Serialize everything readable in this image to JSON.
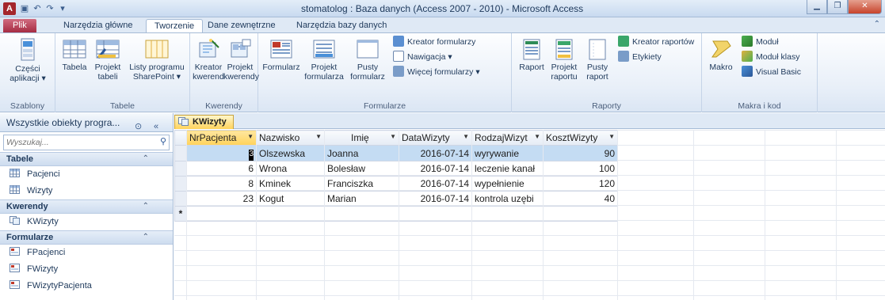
{
  "window": {
    "title": "stomatolog : Baza danych (Access 2007 - 2010)  -  Microsoft Access",
    "app_icon_letter": "A",
    "quick_access": [
      "save-icon",
      "undo-icon",
      "redo-icon",
      "customize-icon"
    ],
    "controls": [
      "minimize",
      "maximize",
      "close"
    ]
  },
  "tabs": [
    {
      "label": "Plik",
      "active": false
    },
    {
      "label": "Narzędzia główne",
      "active": false
    },
    {
      "label": "Tworzenie",
      "active": true
    },
    {
      "label": "Dane zewnętrzne",
      "active": false
    },
    {
      "label": "Narzędzia bazy danych",
      "active": false
    }
  ],
  "ribbon": {
    "groups": {
      "szablony": {
        "label": "Szablony",
        "buttons": [
          {
            "label": "Części\naplikacji ▾"
          }
        ]
      },
      "tabele": {
        "label": "Tabele",
        "buttons": [
          {
            "label": "Tabela"
          },
          {
            "label": "Projekt\ntabeli"
          },
          {
            "label": "Listy programu\nSharePoint ▾"
          }
        ]
      },
      "kwerendy": {
        "label": "Kwerendy",
        "buttons": [
          {
            "label": "Kreator\nkwerend"
          },
          {
            "label": "Projekt\nkwerendy"
          }
        ]
      },
      "formularze": {
        "label": "Formularze",
        "buttons": [
          {
            "label": "Formularz"
          },
          {
            "label": "Projekt\nformularza"
          },
          {
            "label": "Pusty\nformularz"
          }
        ],
        "small": [
          "Kreator formularzy",
          "Nawigacja ▾",
          "Więcej formularzy ▾"
        ]
      },
      "raporty": {
        "label": "Raporty",
        "buttons": [
          {
            "label": "Raport"
          },
          {
            "label": "Projekt\nraportu"
          },
          {
            "label": "Pusty\nraport"
          }
        ],
        "small": [
          "Kreator raportów",
          "Etykiety"
        ]
      },
      "makra": {
        "label": "Makra i kod",
        "buttons": [
          {
            "label": "Makro"
          }
        ],
        "small": [
          "Moduł",
          "Moduł klasy",
          "Visual Basic"
        ]
      }
    }
  },
  "nav": {
    "header": "Wszystkie obiekty progra...",
    "search_placeholder": "Wyszukaj...",
    "groups": [
      {
        "label": "Tabele",
        "items": [
          "Pacjenci",
          "Wizyty"
        ]
      },
      {
        "label": "Kwerendy",
        "items": [
          "KWizyty"
        ]
      },
      {
        "label": "Formularze",
        "items": [
          "FPacjenci",
          "FWizyty",
          "FWizytyPacjenta"
        ]
      }
    ]
  },
  "document": {
    "tab_label": "KWizyty",
    "columns": [
      "NrPacjenta",
      "Nazwisko",
      "Imię",
      "DataWizyty",
      "RodzajWizyt",
      "KosztWizyty"
    ],
    "rows": [
      {
        "nr": "3",
        "nazwisko": "Olszewska",
        "imie": "Joanna",
        "data": "2016-07-14",
        "rodzaj": "wyrywanie",
        "koszt": "90"
      },
      {
        "nr": "6",
        "nazwisko": "Wrona",
        "imie": "Bolesław",
        "data": "2016-07-14",
        "rodzaj": "leczenie kanał",
        "koszt": "100"
      },
      {
        "nr": "8",
        "nazwisko": "Kminek",
        "imie": "Franciszka",
        "data": "2016-07-14",
        "rodzaj": "wypełnienie",
        "koszt": "120"
      },
      {
        "nr": "23",
        "nazwisko": "Kogut",
        "imie": "Marian",
        "data": "2016-07-14",
        "rodzaj": "kontrola uzębi",
        "koszt": "40"
      }
    ],
    "new_row_marker": "*"
  },
  "colors": {
    "file_tab": "#a3283f",
    "accent": "#1e395b",
    "selected_row": "#c4dcf3",
    "header_selected": "#ffd35a"
  }
}
